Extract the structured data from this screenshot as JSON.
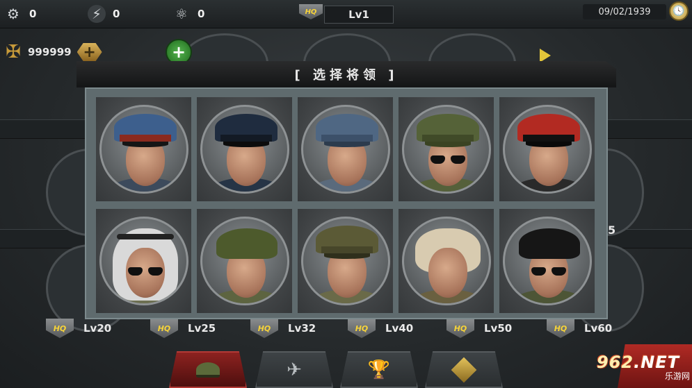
{
  "topbar": {
    "gear_count": "0",
    "energy_count": "0",
    "atom_count": "0",
    "hq_badge": "HQ",
    "hq_level": "Lv1",
    "date": "09/02/1939"
  },
  "currency": {
    "amount": "999999",
    "add_symbol": "+"
  },
  "background": {
    "side_number": "5"
  },
  "modal": {
    "title": "[ 选择将领 ]",
    "generals": [
      {
        "cap": "peaked-blue-red",
        "uniform": "#3c4a5c",
        "glasses": false
      },
      {
        "cap": "peaked-navy",
        "uniform": "#263446",
        "glasses": false
      },
      {
        "cap": "field-grey-blue",
        "uniform": "#5a6a7c",
        "glasses": false
      },
      {
        "cap": "field-olive",
        "uniform": "#55603a",
        "glasses": true
      },
      {
        "cap": "kepi-red-black",
        "uniform": "#2a2a2a",
        "glasses": false
      },
      {
        "cap": "keffiyeh",
        "uniform": "#6d7052",
        "glasses": true
      },
      {
        "cap": "helmet-olive",
        "uniform": "#5d6440",
        "glasses": false
      },
      {
        "cap": "field-khaki",
        "uniform": "#6a6a48",
        "glasses": false
      },
      {
        "cap": "ushanka",
        "uniform": "#6a6040",
        "glasses": false
      },
      {
        "cap": "beret-black",
        "uniform": "#4d5536",
        "glasses": true
      }
    ]
  },
  "levels": [
    {
      "badge": "HQ",
      "label": "Lv20"
    },
    {
      "badge": "HQ",
      "label": "Lv25"
    },
    {
      "badge": "HQ",
      "label": "Lv32"
    },
    {
      "badge": "HQ",
      "label": "Lv40"
    },
    {
      "badge": "HQ",
      "label": "Lv50"
    },
    {
      "badge": "HQ",
      "label": "Lv60"
    }
  ],
  "tabs": [
    "general-icon",
    "wings-icon",
    "trophy-icon",
    "diamond-icon"
  ],
  "watermark": {
    "brand_num": "962",
    "brand_tail": ".NET",
    "sub": "乐游网"
  },
  "colors": {
    "accent_red": "#8d2220",
    "hq_gold": "#f6d33a",
    "modal_frame": "#5f6b6e"
  }
}
